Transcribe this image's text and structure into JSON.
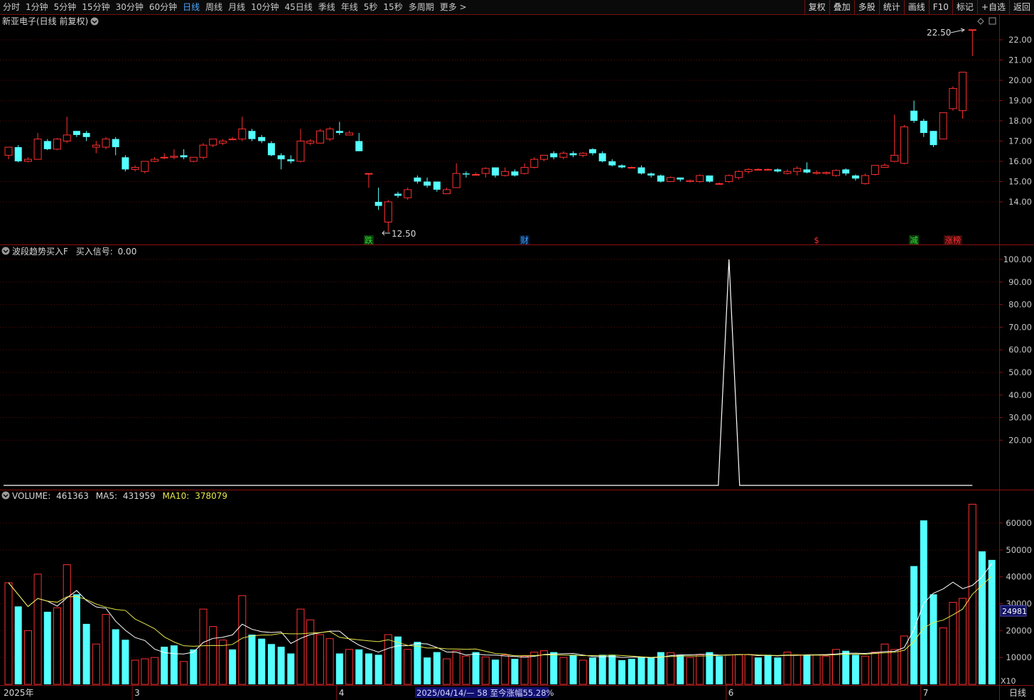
{
  "toolbar": {
    "periods": [
      "分时",
      "1分钟",
      "5分钟",
      "15分钟",
      "30分钟",
      "60分钟",
      "日线",
      "周线",
      "月线",
      "10分钟",
      "45日线",
      "季线",
      "年线",
      "5秒",
      "15秒",
      "多周期",
      "更多 >"
    ],
    "active": "日线",
    "tools": [
      "复权",
      "叠加",
      "多股",
      "统计",
      "画线",
      "F10",
      "标记",
      "+自选",
      "返回"
    ]
  },
  "price_panel": {
    "title": "新亚电子(日线 前复权)",
    "high_label": "22.50",
    "low_label": "12.50",
    "event_markers": [
      {
        "text": "跌",
        "color": "#33dd33",
        "bg": "#0a3a0a",
        "index": 37
      },
      {
        "text": "财",
        "color": "#4aa8ff",
        "bg": "#001a3a",
        "index": 53
      },
      {
        "text": "$",
        "color": "#ff3030",
        "bg": "#000000",
        "index": 83
      },
      {
        "text": "减",
        "color": "#33dd33",
        "bg": "#0a3a0a",
        "index": 93
      },
      {
        "text": "涨榜",
        "color": "#ff3030",
        "bg": "#3a0a0a",
        "index": 97
      }
    ]
  },
  "indicator_panel": {
    "title": "波段趋势买入F",
    "signal_label": "买入信号:",
    "signal_value": "0.00"
  },
  "volume_panel": {
    "vol_label": "VOLUME:",
    "vol_value": "461363",
    "ma5_label": "MA5:",
    "ma5_value": "431959",
    "ma10_label": "MA10:",
    "ma10_value": "378079",
    "current_tag": "24981",
    "unit_tag": "X10"
  },
  "bottom_bar": {
    "year_label": "2025年",
    "month_labels": [
      {
        "text": "3",
        "index": 13
      },
      {
        "text": "4",
        "index": 34
      },
      {
        "text": "6",
        "index": 74
      },
      {
        "text": "7",
        "index": 94
      }
    ],
    "range_info": "2025/04/14/— 58 至今涨幅55.28%",
    "period_tag": "日线"
  },
  "chart_data": {
    "type": "candlestick",
    "price_axis": {
      "ticks": [
        "14.00",
        "15.00",
        "16.00",
        "17.00",
        "18.00",
        "19.00",
        "20.00",
        "21.00",
        "22.00"
      ],
      "range": [
        12.0,
        23.0
      ]
    },
    "indicator_axis": {
      "ticks": [
        "20.00",
        "30.00",
        "40.00",
        "50.00",
        "60.00",
        "70.00",
        "80.00",
        "90.00",
        "100.00"
      ],
      "range": [
        0,
        100
      ]
    },
    "volume_axis": {
      "ticks": [
        "10000",
        "20000",
        "30000",
        "40000",
        "50000",
        "60000"
      ],
      "range": [
        0,
        70000
      ]
    },
    "candles": [
      [
        16.3,
        16.7,
        16.1,
        16.7
      ],
      [
        16.7,
        16.0,
        15.95,
        16.8
      ],
      [
        16.0,
        16.1,
        15.95,
        16.2
      ],
      [
        16.1,
        17.1,
        16.1,
        17.4
      ],
      [
        17.0,
        16.6,
        16.55,
        17.1
      ],
      [
        16.6,
        17.1,
        16.55,
        17.15
      ],
      [
        17.0,
        17.3,
        16.9,
        18.2
      ],
      [
        17.5,
        17.3,
        17.2,
        17.5
      ],
      [
        17.4,
        17.2,
        17.0,
        17.5
      ],
      [
        16.7,
        16.8,
        16.4,
        17.0
      ],
      [
        16.7,
        17.1,
        16.6,
        17.2
      ],
      [
        17.1,
        16.7,
        16.3,
        17.2
      ],
      [
        16.2,
        15.6,
        15.5,
        16.3
      ],
      [
        15.6,
        15.7,
        15.5,
        15.8
      ],
      [
        15.5,
        16.0,
        15.4,
        16.0
      ],
      [
        16.0,
        16.1,
        15.95,
        16.2
      ],
      [
        16.2,
        16.2,
        16.1,
        16.4
      ],
      [
        16.2,
        16.25,
        16.1,
        16.6
      ],
      [
        16.3,
        16.2,
        16.1,
        16.6
      ],
      [
        16.0,
        16.2,
        15.95,
        16.2
      ],
      [
        16.2,
        16.8,
        16.1,
        16.9
      ],
      [
        16.8,
        17.1,
        16.7,
        17.1
      ],
      [
        16.9,
        17.0,
        16.8,
        17.1
      ],
      [
        17.1,
        17.1,
        17.05,
        17.2
      ],
      [
        17.1,
        17.6,
        17.0,
        18.2
      ],
      [
        17.5,
        17.1,
        17.0,
        17.6
      ],
      [
        17.2,
        17.0,
        16.9,
        17.3
      ],
      [
        16.9,
        16.3,
        16.25,
        17.0
      ],
      [
        16.3,
        16.1,
        15.6,
        16.4
      ],
      [
        16.1,
        16.0,
        15.9,
        16.3
      ],
      [
        16.0,
        17.0,
        15.95,
        17.6
      ],
      [
        16.9,
        17.0,
        16.8,
        17.1
      ],
      [
        16.9,
        17.5,
        16.9,
        17.6
      ],
      [
        17.1,
        17.6,
        17.0,
        17.7
      ],
      [
        17.5,
        17.4,
        17.3,
        17.95
      ],
      [
        17.3,
        17.4,
        17.3,
        17.5
      ],
      [
        17.0,
        16.5,
        16.5,
        17.4
      ],
      [
        15.4,
        15.4,
        14.7,
        15.4
      ],
      [
        14.0,
        13.8,
        13.6,
        14.7
      ],
      [
        13.0,
        14.0,
        12.5,
        14.1
      ],
      [
        14.4,
        14.3,
        14.2,
        14.5
      ],
      [
        14.2,
        14.6,
        14.1,
        14.7
      ],
      [
        15.2,
        15.0,
        14.9,
        15.3
      ],
      [
        15.0,
        14.8,
        14.7,
        15.2
      ],
      [
        15.0,
        14.6,
        14.5,
        15.0
      ],
      [
        14.4,
        14.6,
        14.4,
        14.7
      ],
      [
        14.7,
        15.4,
        14.7,
        15.9
      ],
      [
        15.4,
        15.35,
        15.2,
        15.5
      ],
      [
        15.35,
        15.35,
        15.3,
        15.45
      ],
      [
        15.4,
        15.65,
        15.2,
        15.7
      ],
      [
        15.7,
        15.3,
        15.2,
        15.7
      ],
      [
        15.3,
        15.5,
        15.25,
        15.7
      ],
      [
        15.5,
        15.3,
        15.25,
        15.6
      ],
      [
        15.4,
        15.7,
        15.35,
        15.9
      ],
      [
        15.7,
        16.1,
        15.65,
        16.2
      ],
      [
        16.1,
        16.3,
        16.0,
        16.3
      ],
      [
        16.4,
        16.2,
        16.1,
        16.5
      ],
      [
        16.2,
        16.4,
        16.1,
        16.5
      ],
      [
        16.4,
        16.3,
        16.2,
        16.5
      ],
      [
        16.3,
        16.4,
        16.2,
        16.45
      ],
      [
        16.6,
        16.4,
        16.3,
        16.65
      ],
      [
        16.4,
        16.0,
        15.95,
        16.5
      ],
      [
        16.0,
        15.8,
        15.75,
        16.1
      ],
      [
        15.8,
        15.7,
        15.65,
        15.85
      ],
      [
        15.7,
        15.7,
        15.65,
        15.75
      ],
      [
        15.7,
        15.4,
        15.35,
        15.8
      ],
      [
        15.4,
        15.3,
        15.2,
        15.45
      ],
      [
        15.3,
        15.0,
        14.95,
        15.35
      ],
      [
        15.0,
        15.2,
        15.0,
        15.25
      ],
      [
        15.2,
        15.1,
        15.0,
        15.2
      ],
      [
        15.0,
        15.05,
        14.95,
        15.1
      ],
      [
        15.0,
        15.3,
        14.95,
        15.35
      ],
      [
        15.3,
        15.0,
        14.95,
        15.3
      ],
      [
        14.9,
        14.9,
        14.85,
        14.95
      ],
      [
        15.0,
        15.3,
        14.95,
        15.35
      ],
      [
        15.2,
        15.5,
        15.1,
        15.55
      ],
      [
        15.5,
        15.6,
        15.4,
        15.65
      ],
      [
        15.6,
        15.6,
        15.55,
        15.65
      ],
      [
        15.6,
        15.6,
        15.55,
        15.65
      ],
      [
        15.6,
        15.5,
        15.45,
        15.65
      ],
      [
        15.4,
        15.5,
        15.35,
        15.6
      ],
      [
        15.5,
        15.65,
        15.3,
        15.75
      ],
      [
        15.6,
        15.45,
        15.4,
        15.95
      ],
      [
        15.4,
        15.45,
        15.35,
        15.55
      ],
      [
        15.4,
        15.45,
        15.35,
        15.5
      ],
      [
        15.3,
        15.55,
        15.25,
        15.6
      ],
      [
        15.6,
        15.4,
        15.3,
        15.65
      ],
      [
        15.3,
        15.15,
        15.05,
        15.35
      ],
      [
        14.9,
        15.3,
        14.85,
        15.4
      ],
      [
        15.35,
        15.8,
        15.3,
        15.8
      ],
      [
        15.7,
        15.8,
        15.7,
        15.9
      ],
      [
        16.0,
        16.3,
        15.95,
        18.3
      ],
      [
        15.9,
        17.7,
        15.85,
        17.8
      ],
      [
        18.5,
        18.0,
        17.9,
        19.0
      ],
      [
        18.0,
        17.4,
        17.2,
        18.1
      ],
      [
        17.5,
        16.8,
        16.7,
        17.5
      ],
      [
        17.1,
        18.4,
        17.1,
        18.4
      ],
      [
        18.6,
        19.6,
        18.5,
        19.7
      ],
      [
        18.5,
        20.4,
        18.1,
        20.4
      ],
      [
        22.5,
        22.5,
        21.2,
        22.5
      ]
    ],
    "volume": [
      37800,
      29000,
      20000,
      41000,
      27000,
      28500,
      44500,
      33500,
      22500,
      15000,
      26000,
      20500,
      16600,
      9000,
      9500,
      10000,
      14000,
      14500,
      8500,
      13000,
      28000,
      21500,
      16500,
      13000,
      33000,
      18500,
      17000,
      15000,
      14000,
      11500,
      28000,
      24000,
      18500,
      17000,
      11500,
      13000,
      13000,
      11500,
      11000,
      18500,
      17800,
      13000,
      15800,
      10000,
      12000,
      9500,
      12500,
      10500,
      12000,
      10200,
      9200,
      11000,
      9500,
      10500,
      12000,
      12500,
      12000,
      10000,
      11000,
      9000,
      10000,
      11000,
      11000,
      9000,
      9500,
      10000,
      10000,
      12000,
      11800,
      11000,
      10000,
      11000,
      12000,
      10500,
      11000,
      11000,
      11000,
      10000,
      11000,
      10000,
      12000,
      11000,
      11000,
      11000,
      10500,
      13000,
      12500,
      11000,
      10500,
      12000,
      15000,
      13000,
      18000,
      44000,
      61000,
      33500,
      21000,
      30500,
      32000,
      67000,
      49500,
      46300
    ],
    "volume_up": [
      1,
      0,
      1,
      1,
      0,
      1,
      1,
      0,
      0,
      1,
      1,
      0,
      0,
      1,
      1,
      1,
      0,
      0,
      1,
      0,
      1,
      1,
      1,
      0,
      1,
      0,
      0,
      0,
      0,
      0,
      1,
      1,
      1,
      1,
      0,
      1,
      0,
      0,
      0,
      1,
      0,
      1,
      0,
      0,
      0,
      1,
      1,
      1,
      0,
      1,
      0,
      1,
      0,
      1,
      1,
      1,
      0,
      1,
      0,
      1,
      0,
      0,
      0,
      0,
      0,
      0,
      0,
      0,
      1,
      0,
      1,
      1,
      0,
      0,
      1,
      1,
      1,
      0,
      0,
      0,
      1,
      1,
      0,
      1,
      1,
      1,
      0,
      0,
      1,
      1,
      1,
      1,
      1,
      0,
      0,
      0,
      1,
      1,
      1,
      1
    ],
    "indicator": {
      "spike_index": 74,
      "spike_value": 100,
      "baseline": 0
    }
  }
}
